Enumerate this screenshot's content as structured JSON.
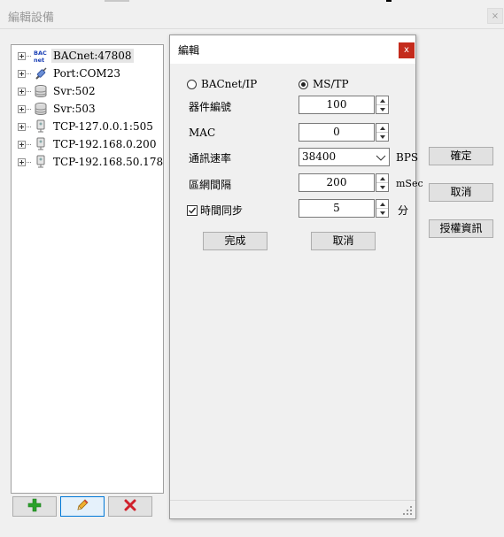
{
  "window": {
    "title": "編輯設備",
    "close_glyph": "×"
  },
  "tree": {
    "items": [
      {
        "label": "BACnet:47808",
        "icon": "bacnet-icon",
        "selected": true
      },
      {
        "label": "Port:COM23",
        "icon": "serial-port-icon"
      },
      {
        "label": "Svr:502",
        "icon": "server-db-icon"
      },
      {
        "label": "Svr:503",
        "icon": "server-db-icon"
      },
      {
        "label": "TCP-127.0.0.1:505",
        "icon": "tcp-device-icon"
      },
      {
        "label": "TCP-192.168.0.200",
        "icon": "tcp-device-icon"
      },
      {
        "label": "TCP-192.168.50.178",
        "icon": "tcp-device-icon"
      }
    ]
  },
  "toolbar": {
    "add_icon": "plus-icon",
    "edit_icon": "pencil-icon",
    "delete_icon": "delete-x-icon"
  },
  "main_buttons": {
    "confirm": "確定",
    "cancel": "取消",
    "license": "授權資訊"
  },
  "dialog": {
    "title": "編輯",
    "close_glyph": "x",
    "protocol": {
      "option1": "BACnet/IP",
      "option2": "MS/TP",
      "selected": "MS/TP"
    },
    "device_id": {
      "label": "器件編號",
      "value": "100"
    },
    "mac": {
      "label": "MAC",
      "value": "0"
    },
    "baud": {
      "label": "通訊速率",
      "value": "38400",
      "unit": "BPS"
    },
    "interval": {
      "label": "區網間隔",
      "value": "200",
      "unit": "mSec"
    },
    "time_sync": {
      "label": "時間同步",
      "checked": true,
      "value": "5",
      "unit": "分"
    },
    "done_label": "完成",
    "cancel_label": "取消"
  },
  "colors": {
    "close_red": "#c42b1c",
    "add_green": "#2aa12a",
    "delete_red": "#d0202b",
    "focus_blue": "#0078d7"
  }
}
